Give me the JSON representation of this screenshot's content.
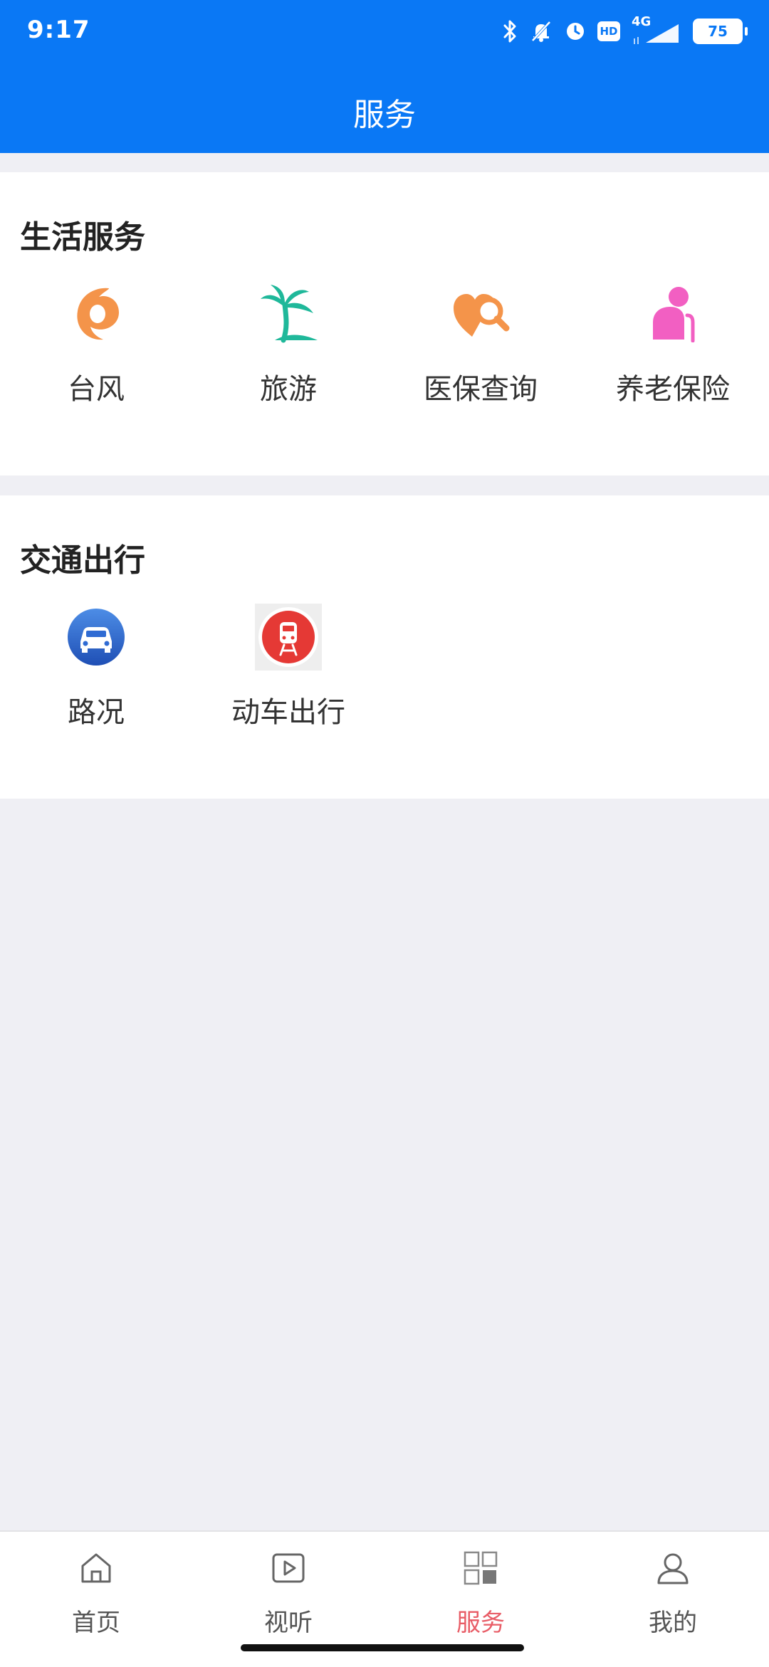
{
  "status": {
    "time": "9:17",
    "network": "4G",
    "hd": "HD",
    "battery": "75"
  },
  "header": {
    "title": "服务"
  },
  "sections": [
    {
      "title": "生活服务",
      "items": [
        {
          "label": "台风",
          "icon": "typhoon-icon"
        },
        {
          "label": "旅游",
          "icon": "palm-tree-icon"
        },
        {
          "label": "医保查询",
          "icon": "medical-insurance-search-icon"
        },
        {
          "label": "养老保险",
          "icon": "elderly-person-icon"
        }
      ]
    },
    {
      "title": "交通出行",
      "items": [
        {
          "label": "路况",
          "icon": "car-icon"
        },
        {
          "label": "动车出行",
          "icon": "train-icon"
        }
      ]
    }
  ],
  "bottom_nav": {
    "items": [
      {
        "label": "首页",
        "icon": "home-icon",
        "active": false
      },
      {
        "label": "视听",
        "icon": "play-icon",
        "active": false
      },
      {
        "label": "服务",
        "icon": "services-grid-icon",
        "active": true
      },
      {
        "label": "我的",
        "icon": "user-icon",
        "active": false
      }
    ]
  },
  "colors": {
    "header_bg": "#0a78f5",
    "page_bg": "#efeff4",
    "active_nav": "#e85c66",
    "typhoon": "#f4944a",
    "palm": "#1fb89a",
    "medical": "#f4944a",
    "elderly": "#f25fc2",
    "car_blue": "#2f6bd3",
    "train_red": "#e53935"
  }
}
